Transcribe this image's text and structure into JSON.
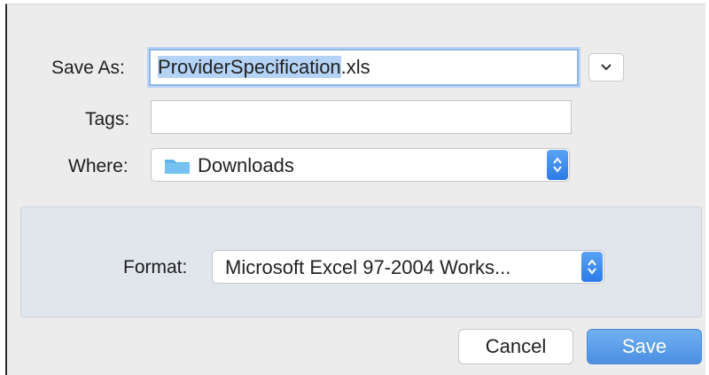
{
  "dialog": {
    "save_as": {
      "label": "Save As:",
      "filename_selected": "ProviderSpecification",
      "filename_rest": ".xls"
    },
    "expand_button_icon": "chevron-down-icon",
    "tags": {
      "label": "Tags:",
      "value": ""
    },
    "where": {
      "label": "Where:",
      "value": "Downloads",
      "icon": "folder-icon"
    },
    "format": {
      "label": "Format:",
      "value": "Microsoft Excel 97-2004 Works..."
    },
    "buttons": {
      "cancel": "Cancel",
      "save": "Save"
    },
    "colors": {
      "accent": "#4c8fe2",
      "folder": "#5db3ea",
      "selection": "#b4d3f6"
    }
  }
}
